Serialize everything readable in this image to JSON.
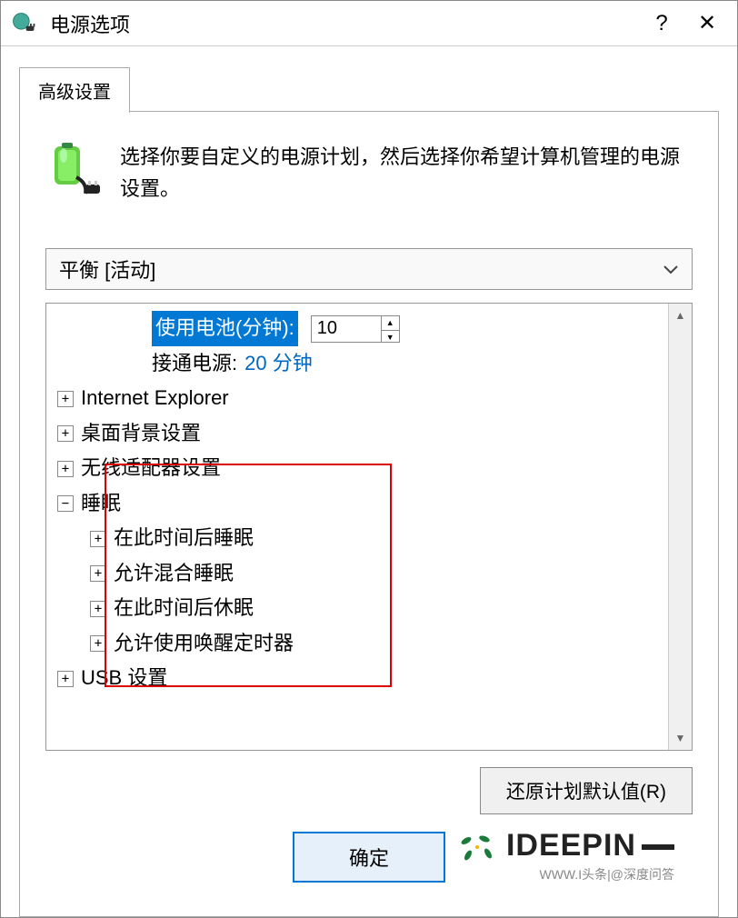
{
  "titlebar": {
    "title": "电源选项",
    "help": "?",
    "close": "✕"
  },
  "tab": {
    "label": "高级设置"
  },
  "intro": {
    "text": "选择你要自定义的电源计划，然后选择你希望计算机管理的电源设置。"
  },
  "plan_select": {
    "value": "平衡 [活动]"
  },
  "tree": {
    "battery_label": "使用电池(分钟):",
    "battery_value": "10",
    "plugged_label": "接通电源:",
    "plugged_value": "20 分钟",
    "ie": "Internet Explorer",
    "desktop_bg": "桌面背景设置",
    "wireless": "无线适配器设置",
    "sleep": "睡眠",
    "sleep_after": "在此时间后睡眠",
    "hybrid_sleep": "允许混合睡眠",
    "hibernate_after": "在此时间后休眠",
    "wake_timers": "允许使用唤醒定时器",
    "usb": "USB 设置"
  },
  "buttons": {
    "restore": "还原计划默认值(R)",
    "ok": "确定"
  },
  "watermark": {
    "logo": "IDEEPIN",
    "url": "WWW.I头条|@深度问答"
  }
}
